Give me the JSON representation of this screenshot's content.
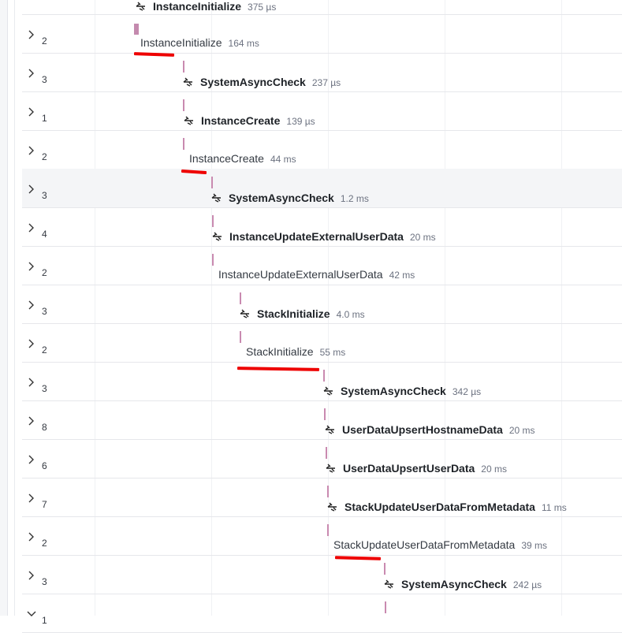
{
  "rows": [
    {
      "count": "",
      "name": "InstanceInitialize",
      "duration": "375 µs",
      "bold": true,
      "icon": "async-call-icon"
    },
    {
      "count": "2",
      "name": "InstanceInitialize",
      "duration": "164 ms",
      "bold": false,
      "icon": ""
    },
    {
      "count": "3",
      "name": "SystemAsyncCheck",
      "duration": "237 µs",
      "bold": true,
      "icon": "async-call-icon"
    },
    {
      "count": "1",
      "name": "InstanceCreate",
      "duration": "139 µs",
      "bold": true,
      "icon": "async-call-icon"
    },
    {
      "count": "2",
      "name": "InstanceCreate",
      "duration": "44 ms",
      "bold": false,
      "icon": ""
    },
    {
      "count": "3",
      "name": "SystemAsyncCheck",
      "duration": "1.2 ms",
      "bold": true,
      "icon": "async-call-icon"
    },
    {
      "count": "4",
      "name": "InstanceUpdateExternalUserData",
      "duration": "20 ms",
      "bold": true,
      "icon": "async-call-icon"
    },
    {
      "count": "2",
      "name": "InstanceUpdateExternalUserData",
      "duration": "42 ms",
      "bold": false,
      "icon": ""
    },
    {
      "count": "3",
      "name": "StackInitialize",
      "duration": "4.0 ms",
      "bold": true,
      "icon": "async-call-icon"
    },
    {
      "count": "2",
      "name": "StackInitialize",
      "duration": "55 ms",
      "bold": false,
      "icon": ""
    },
    {
      "count": "3",
      "name": "SystemAsyncCheck",
      "duration": "342 µs",
      "bold": true,
      "icon": "async-call-icon"
    },
    {
      "count": "8",
      "name": "UserDataUpsertHostnameData",
      "duration": "20 ms",
      "bold": true,
      "icon": "async-call-icon"
    },
    {
      "count": "6",
      "name": "UserDataUpsertUserData",
      "duration": "20 ms",
      "bold": true,
      "icon": "async-call-icon"
    },
    {
      "count": "7",
      "name": "StackUpdateUserDataFromMetadata",
      "duration": "11 ms",
      "bold": true,
      "icon": "async-call-icon"
    },
    {
      "count": "2",
      "name": "StackUpdateUserDataFromMetadata",
      "duration": "39 ms",
      "bold": false,
      "icon": ""
    },
    {
      "count": "3",
      "name": "SystemAsyncCheck",
      "duration": "242 µs",
      "bold": true,
      "icon": "async-call-icon"
    },
    {
      "count": "1",
      "name": "",
      "duration": "",
      "bold": false,
      "icon": ""
    }
  ],
  "colors": {
    "marker": "#c98ab0",
    "annotation": "#ee0000",
    "row_highlight": "#f4f5f7"
  }
}
